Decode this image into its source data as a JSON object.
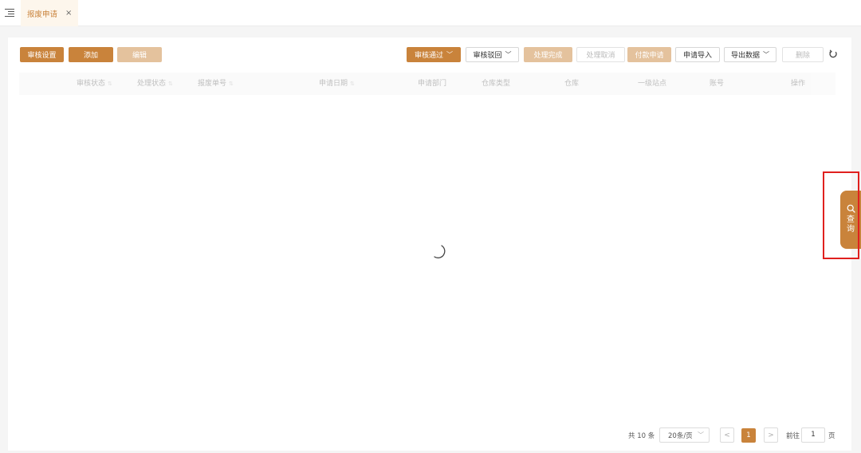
{
  "tab": {
    "label": "报废申请",
    "close": "×"
  },
  "toolbar_left": {
    "audit_settings": "审核设置",
    "add": "添加",
    "edit": "编辑"
  },
  "toolbar_right": {
    "approve": "审核通过",
    "reject": "审核驳回",
    "process_done": "处理完成",
    "process_cancel": "处理取消",
    "payment_apply": "付款申请",
    "apply_import": "申请导入",
    "export_data": "导出数据",
    "delete": "删除"
  },
  "table": {
    "columns": [
      "审核状态",
      "处理状态",
      "报废单号",
      "申请日期",
      "申请部门",
      "仓库类型",
      "仓库",
      "一级站点",
      "账号",
      "操作"
    ],
    "rows": []
  },
  "pagination": {
    "total": "共 10 条",
    "page_size": "20条/页",
    "prev": "<",
    "current": "1",
    "next": ">",
    "goto_label": "前往",
    "goto_value": "1",
    "page_suffix": "页"
  },
  "side_query": {
    "label": "查询"
  },
  "colors": {
    "accent": "#c9833b",
    "highlight": "#e0201e"
  },
  "icons": {
    "menu": "menu-toggle-icon",
    "refresh": "refresh-icon",
    "search": "search-icon",
    "loading": "loading-spinner-icon"
  }
}
